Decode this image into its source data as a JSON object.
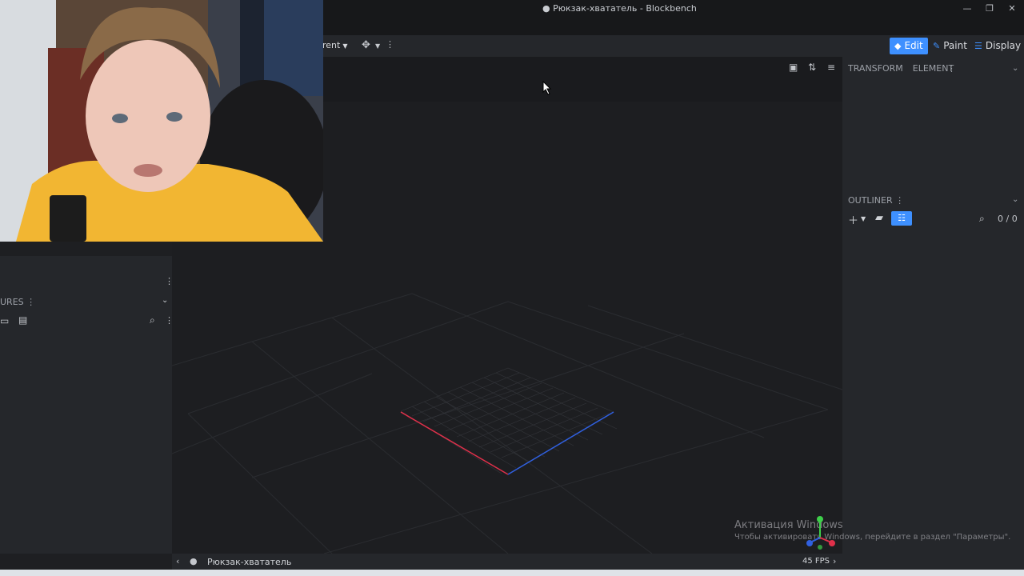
{
  "window": {
    "title": "● Рюкзак-хвататель - Blockbench",
    "minimize_glyph": "—",
    "restore_glyph": "❐",
    "close_glyph": "✕"
  },
  "toolbar": {
    "pivot_select_value": "rent",
    "modes": [
      {
        "label": "Edit",
        "icon": "edit-cube-icon",
        "active": true
      },
      {
        "label": "Paint",
        "icon": "brush-icon",
        "active": false
      },
      {
        "label": "Display",
        "icon": "sliders-icon",
        "active": false
      }
    ]
  },
  "right_panel": {
    "tabs": [
      "TRANSFORM",
      "ELEMENT"
    ],
    "outliner_title": "OUTLINER",
    "outliner_counter": "0 / 0"
  },
  "left_panel": {
    "textures_title": "URES"
  },
  "status_bar": {
    "project_name": "Рюкзак-хвататель",
    "fps": "45 FPS"
  },
  "watermark": {
    "line1": "Активация Windows",
    "line2": "Чтобы активировать Windows, перейдите в раздел \"Параметры\"."
  },
  "colors": {
    "accent": "#3e90ff",
    "axis_x": "#e0304a",
    "axis_z": "#3060e0",
    "axis_y": "#3ecf4a"
  }
}
